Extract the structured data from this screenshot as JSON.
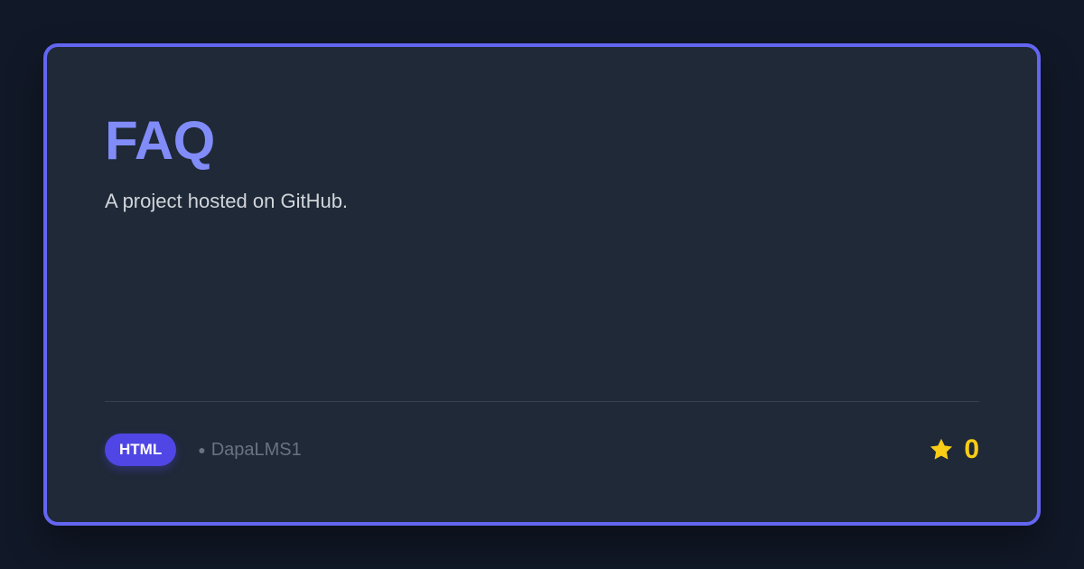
{
  "card": {
    "title": "FAQ",
    "description": "A project hosted on GitHub.",
    "language": "HTML",
    "owner_dot": "●",
    "owner": "DapaLMS1",
    "stars": "0",
    "star_icon": "star-icon"
  },
  "colors": {
    "background": "#111827",
    "card_background": "#1f2937",
    "border": "#6366f1",
    "title": "#818cf8",
    "badge": "#4f46e5",
    "star": "#facc15"
  }
}
